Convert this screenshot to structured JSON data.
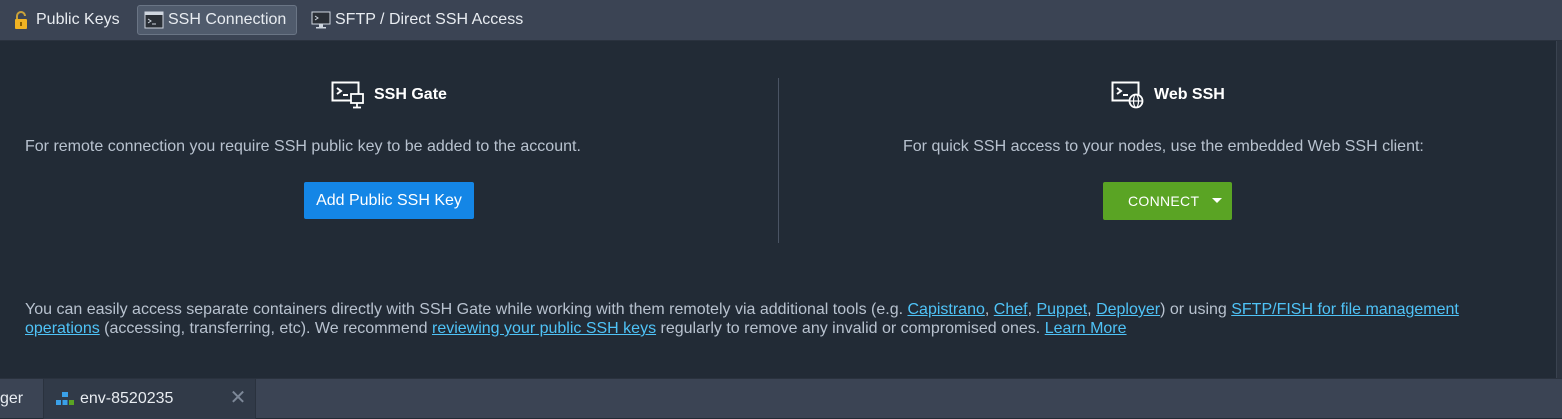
{
  "tabs": [
    {
      "label": "Public Keys",
      "icon": "lock-open-icon",
      "active": false
    },
    {
      "label": "SSH Connection",
      "icon": "terminal-window-icon",
      "active": true
    },
    {
      "label": "SFTP / Direct SSH Access",
      "icon": "monitor-terminal-icon",
      "active": false
    }
  ],
  "ssh_gate": {
    "title": "SSH Gate",
    "icon": "terminal-gate-icon",
    "description": "For remote connection you require SSH public key to be added to the account.",
    "button_label": "Add Public SSH Key"
  },
  "web_ssh": {
    "title": "Web SSH",
    "icon": "terminal-web-icon",
    "description": "For quick SSH access to your nodes, use the embedded Web SSH client:",
    "button_label": "CONNECT"
  },
  "info": {
    "text_1": "You can easily access separate containers directly with SSH Gate while working with them remotely via additional tools (e.g. ",
    "link_capistrano": "Capistrano",
    "sep_1": ", ",
    "link_chef": "Chef",
    "sep_2": ", ",
    "link_puppet": "Puppet",
    "sep_3": ", ",
    "link_deployer": "Deployer",
    "text_2": ") or using ",
    "link_sftp": "SFTP/FISH for file management operations",
    "text_3": " (accessing, transferring, etc). We recommend ",
    "link_review": "reviewing your public SSH keys",
    "text_4": " regularly to remove any invalid or compromised ones. ",
    "link_learn": "Learn More"
  },
  "bottom_tabs": {
    "prev_label": "ger",
    "env_label": "env-8520235",
    "close_glyph": "✕"
  },
  "colors": {
    "accent_blue": "#1486e6",
    "connect_green": "#5aa424",
    "link": "#4fc3f7",
    "lock_yellow": "#f0b323"
  }
}
